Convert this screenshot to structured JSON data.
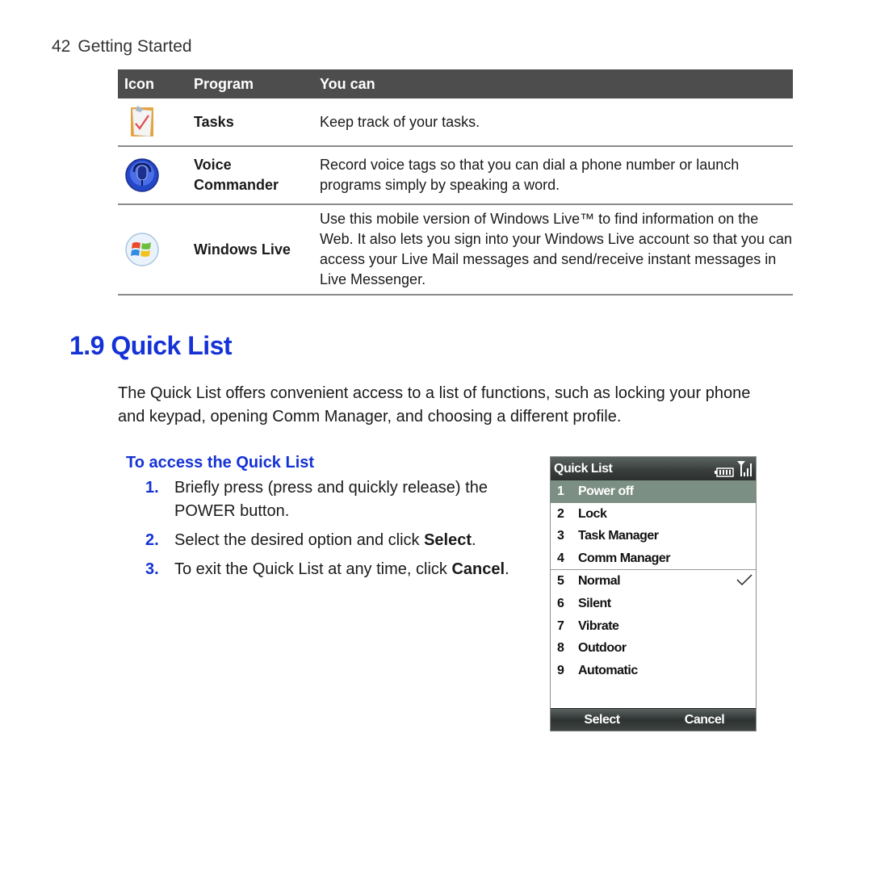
{
  "running_head": {
    "page_number": "42",
    "chapter": "Getting Started"
  },
  "table": {
    "headers": [
      "Icon",
      "Program",
      "You can"
    ],
    "rows": [
      {
        "icon": "tasks-clipboard-icon",
        "program": "Tasks",
        "description": "Keep track of your tasks."
      },
      {
        "icon": "voice-commander-microphone-icon",
        "program_line1": "Voice",
        "program_line2": "Commander",
        "description": "Record voice tags so that you can dial a phone number or launch programs simply by speaking a word."
      },
      {
        "icon": "windows-live-logo-icon",
        "program": "Windows Live",
        "description": "Use this mobile version of Windows Live™ to find information on the Web. It also lets you sign into your Windows Live account so that you can access your Live Mail messages and send/receive instant messages in Live Messenger."
      }
    ]
  },
  "section": {
    "title": "1.9 Quick List",
    "intro": "The Quick List offers convenient access to a list of functions, such as locking your phone and keypad, opening Comm Manager, and choosing a different profile."
  },
  "procedure": {
    "title": "To access the Quick List",
    "steps": [
      {
        "num": "1.",
        "text": "Briefly press (press and quickly release) the POWER button."
      },
      {
        "num": "2.",
        "text_before": "Select the desired option and click ",
        "bold": "Select",
        "text_after": "."
      },
      {
        "num": "3.",
        "text_before": "To exit the Quick List at any time, click ",
        "bold": "Cancel",
        "text_after": "."
      }
    ]
  },
  "phone_screen": {
    "title": "Quick List",
    "status_icons": [
      "battery-icon",
      "signal-strength-icon"
    ],
    "items": [
      {
        "num": "1",
        "label": "Power off",
        "selected": true
      },
      {
        "num": "2",
        "label": "Lock"
      },
      {
        "num": "3",
        "label": "Task Manager"
      },
      {
        "num": "4",
        "label": "Comm Manager"
      },
      {
        "num": "5",
        "label": "Normal",
        "checked": true
      },
      {
        "num": "6",
        "label": "Silent"
      },
      {
        "num": "7",
        "label": "Vibrate"
      },
      {
        "num": "8",
        "label": "Outdoor"
      },
      {
        "num": "9",
        "label": "Automatic"
      }
    ],
    "softkeys": {
      "left": "Select",
      "right": "Cancel"
    }
  },
  "colors": {
    "heading_blue": "#1432d6",
    "table_header": "#4d4d4d",
    "selection": "#7c8f84"
  }
}
